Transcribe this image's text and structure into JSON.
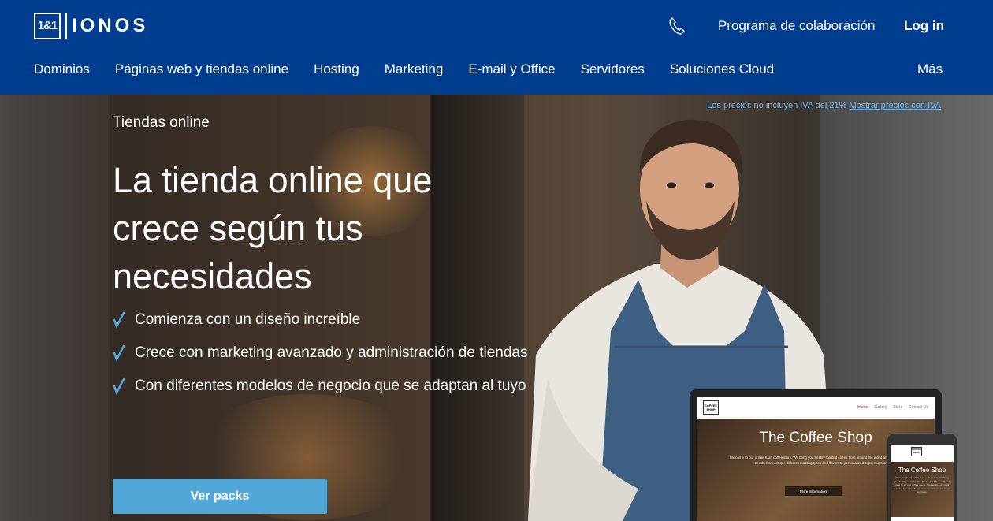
{
  "brand": {
    "logo_mark": "1&1",
    "logo_text": "IONOS"
  },
  "header": {
    "partner_program": "Programa de colaboración",
    "login": "Log in",
    "more": "Más"
  },
  "nav": [
    "Dominios",
    "Páginas web y tiendas online",
    "Hosting",
    "Marketing",
    "E-mail y Office",
    "Servidores",
    "Soluciones Cloud"
  ],
  "hero": {
    "tax_note": "Los precios no incluyen IVA del 21%",
    "tax_link": "Mostrar precios con IVA",
    "eyebrow": "Tiendas online",
    "headline": "La tienda online que crece según tus necesidades",
    "features": [
      "Comienza con un diseño increíble",
      "Crece con marketing avanzado y administración de tiendas",
      "Con diferentes modelos de negocio que se adaptan al tuyo"
    ],
    "cta": "Ver packs"
  },
  "mockup": {
    "logo": "COFFEE SHOP",
    "nav_links": [
      "Home",
      "Gallery",
      "Store",
      "Contact Us"
    ],
    "title": "The Coffee Shop",
    "text": "Welcome to our online Kraft coffee store. We bring you freshly roasted coffee from around the world and cater to all your coffee needs, from antique different roasting types and flavors to personalized cups, mugs and bags.",
    "button": "More Information"
  },
  "colors": {
    "header_bg": "#003d8f",
    "cta_bg": "#52a7d9",
    "check": "#52a7d9"
  },
  "icons": {
    "phone": "phone-icon",
    "check": "check-icon"
  }
}
